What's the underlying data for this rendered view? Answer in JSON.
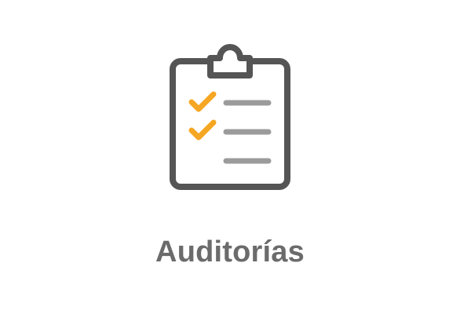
{
  "tile": {
    "icon": "clipboard-checklist-icon",
    "label": "Auditorías"
  },
  "colors": {
    "outline": "#555555",
    "check": "#f5a623",
    "lines": "#9b9b9b",
    "label": "#6b6b6b",
    "background": "#ffffff"
  },
  "checklist": {
    "items": [
      {
        "checked": true
      },
      {
        "checked": true
      },
      {
        "checked": false
      }
    ]
  }
}
